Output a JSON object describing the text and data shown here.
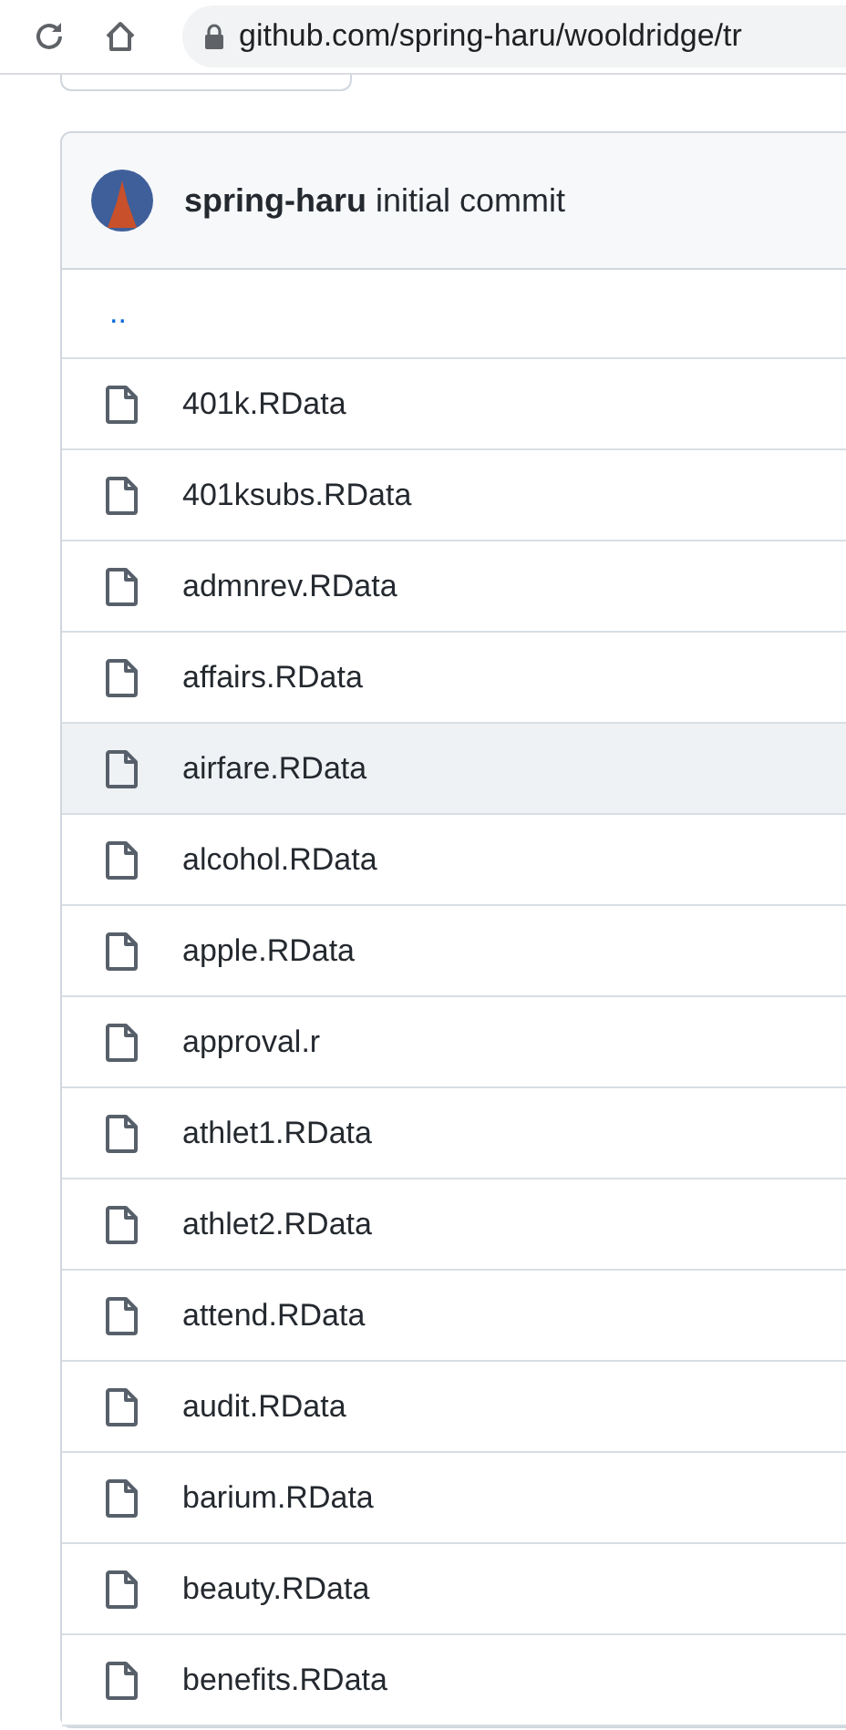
{
  "browser": {
    "url": "github.com/spring-haru/wooldridge/tr"
  },
  "commit": {
    "author": "spring-haru",
    "message": "initial commit"
  },
  "parent_link": "..",
  "files": [
    {
      "name": "401k.RData",
      "hovered": false
    },
    {
      "name": "401ksubs.RData",
      "hovered": false
    },
    {
      "name": "admnrev.RData",
      "hovered": false
    },
    {
      "name": "affairs.RData",
      "hovered": false
    },
    {
      "name": "airfare.RData",
      "hovered": true
    },
    {
      "name": "alcohol.RData",
      "hovered": false
    },
    {
      "name": "apple.RData",
      "hovered": false
    },
    {
      "name": "approval.r",
      "hovered": false
    },
    {
      "name": "athlet1.RData",
      "hovered": false
    },
    {
      "name": "athlet2.RData",
      "hovered": false
    },
    {
      "name": "attend.RData",
      "hovered": false
    },
    {
      "name": "audit.RData",
      "hovered": false
    },
    {
      "name": "barium.RData",
      "hovered": false
    },
    {
      "name": "beauty.RData",
      "hovered": false
    },
    {
      "name": "benefits.RData",
      "hovered": false
    }
  ]
}
